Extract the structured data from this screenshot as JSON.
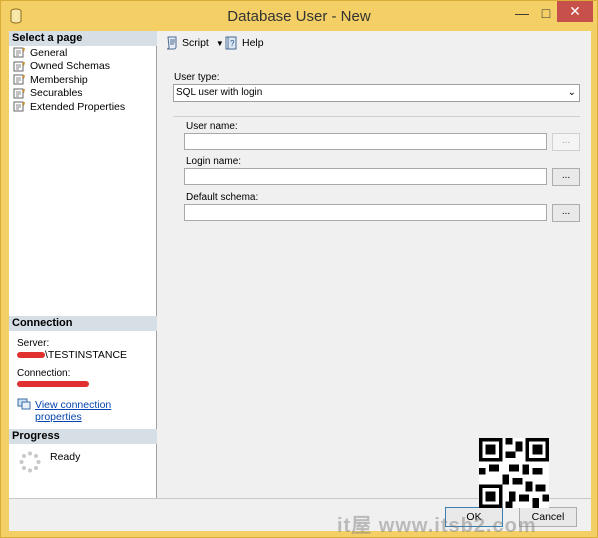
{
  "window": {
    "title": "Database User - New"
  },
  "titlebar": {
    "minimize": "—",
    "maximize": "□",
    "close": "✕"
  },
  "left": {
    "select_page_header": "Select a page",
    "pages": [
      "General",
      "Owned Schemas",
      "Membership",
      "Securables",
      "Extended Properties"
    ],
    "connection_header": "Connection",
    "server_label": "Server:",
    "server_value": "\\TESTINSTANCE",
    "connection_label": "Connection:",
    "view_connection_properties": "View connection properties",
    "progress_header": "Progress",
    "progress_status": "Ready"
  },
  "toolbar": {
    "script": "Script",
    "help": "Help"
  },
  "main": {
    "user_type_label": "User type:",
    "user_type_value": "SQL user with login",
    "user_name_label": "User name:",
    "user_name_value": "",
    "login_name_label": "Login name:",
    "login_name_value": "",
    "default_schema_label": "Default schema:",
    "default_schema_value": "",
    "ellipsis": "..."
  },
  "buttons": {
    "ok": "OK",
    "cancel": "Cancel"
  },
  "watermark": "it屋 www.itsb2.com",
  "colors": {
    "titlebar": "#f3cf66",
    "close": "#c7504a",
    "header": "#d5dfe5",
    "link": "#0645ad"
  },
  "icons": [
    "database-icon",
    "page-icon",
    "script-icon",
    "help-icon",
    "dropdown-arrow-icon",
    "connection-properties-icon",
    "progress-spinner-icon",
    "qr-code"
  ]
}
